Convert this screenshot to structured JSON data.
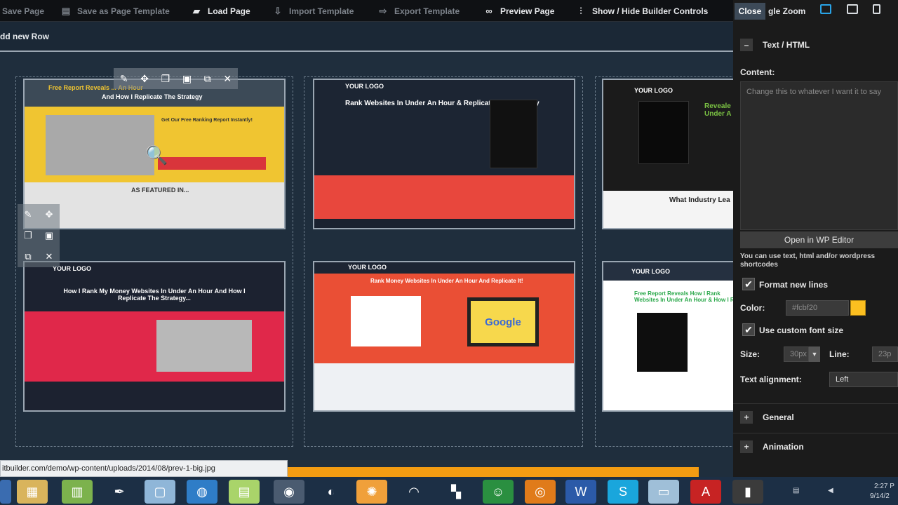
{
  "toolbar": {
    "save_page": "Save Page",
    "save_template": "Save as Page Template",
    "load_page": "Load Page",
    "import_template": "Import Template",
    "export_template": "Export Template",
    "preview_page": "Preview Page",
    "show_hide": "Show / Hide Builder Controls",
    "toggle_zoom": "gle Zoom"
  },
  "canvas": {
    "add_new_row": "dd new Row",
    "thumbs": [
      {
        "headline": "Free Report Reveals ... An Hour",
        "sub": "And How I Replicate The Strategy",
        "cta": "Get Our Free Ranking Report Instantly!",
        "feature": "AS FEATURED IN..."
      },
      {
        "logo": "YOUR LOGO",
        "headline": "Rank Websites In Under An Hour & Replicate The Strategy"
      },
      {
        "logo": "YOUR LOGO",
        "headline": "Reveale Under A",
        "footer": "What Industry Lea"
      },
      {
        "logo": "YOUR LOGO",
        "headline": "How I Rank My Money Websites In Under An Hour And How I Replicate The Strategy..."
      },
      {
        "logo": "YOUR LOGO",
        "headline": "Rank Money Websites In Under An Hour And Replicate It!",
        "google": "Google"
      },
      {
        "logo": "YOUR LOGO",
        "headline": "Free Report Reveals How I Rank Websites In Under An Hour & How I R"
      }
    ]
  },
  "panel": {
    "close": "Close",
    "section_title": "Text / HTML",
    "content_label": "Content:",
    "content_value": "Change this to whatever I want it to say",
    "wp_editor": "Open in WP Editor",
    "note": "You can use text, html and/or wordpress shortcodes",
    "format_new_lines": "Format new lines",
    "color_label": "Color:",
    "color_value": "#fcbf20",
    "custom_font": "Use custom font size",
    "size_label": "Size:",
    "size_value": "30px",
    "line_label": "Line:",
    "line_value": "23p",
    "align_label": "Text alignment:",
    "align_value": "Left",
    "general": "General",
    "animation": "Animation"
  },
  "status_url": "itbuilder.com/demo/wp-content/uploads/2014/08/prev-1-big.jpg",
  "tray": {
    "time": "2:27 P",
    "date": "9/14/2"
  },
  "colors": {
    "accent": "#fcbf20",
    "orange": "#f39c12",
    "canvas": "#1f2e3d"
  }
}
